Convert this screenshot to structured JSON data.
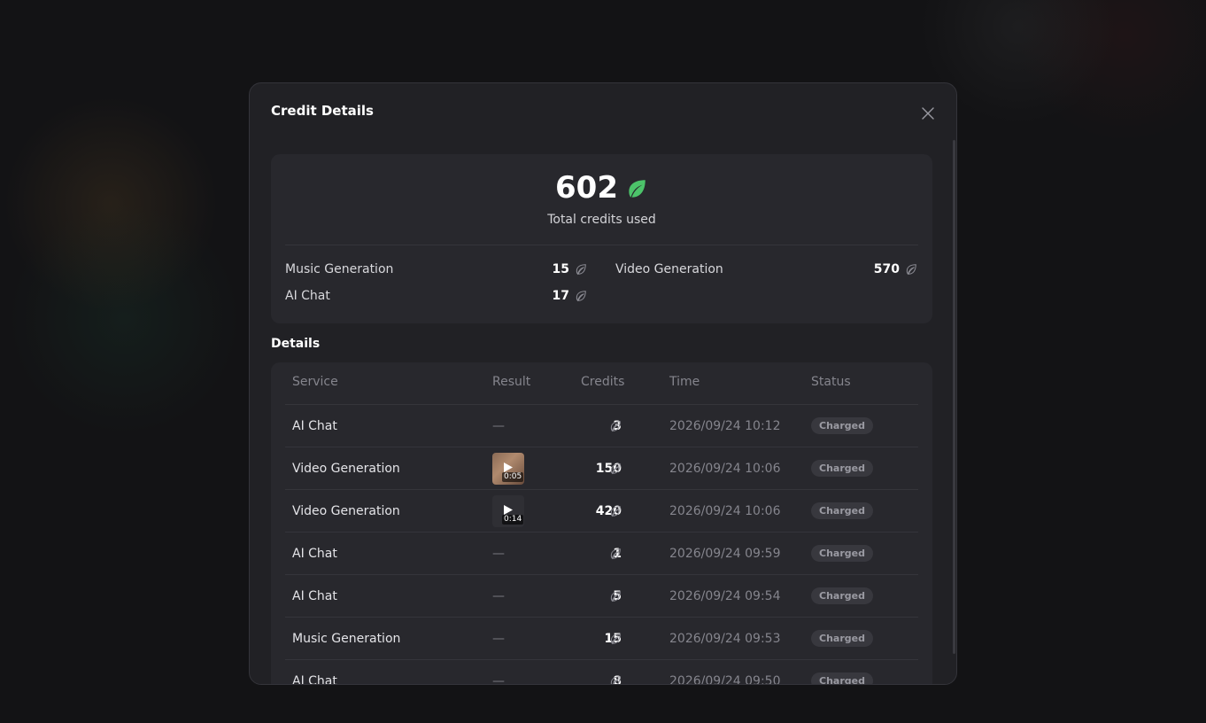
{
  "modal": {
    "title": "Credit Details"
  },
  "summary": {
    "total": "602",
    "total_label": "Total credits used",
    "breakdown": [
      {
        "name": "Music Generation",
        "amount": "15"
      },
      {
        "name": "Video Generation",
        "amount": "570"
      },
      {
        "name": "AI Chat",
        "amount": "17"
      }
    ]
  },
  "details": {
    "heading": "Details",
    "columns": {
      "service": "Service",
      "result": "Result",
      "credits": "Credits",
      "time": "Time",
      "status": "Status"
    },
    "rows": [
      {
        "service": "AI Chat",
        "result": "—",
        "credits": "3",
        "time": "2026/09/24 10:12",
        "status": "Charged"
      },
      {
        "service": "Video Generation",
        "result_thumb": "photo",
        "duration": "0:05",
        "credits": "150",
        "time": "2026/09/24 10:06",
        "status": "Charged"
      },
      {
        "service": "Video Generation",
        "result_thumb": "dark",
        "duration": "0:14",
        "credits": "420",
        "time": "2026/09/24 10:06",
        "status": "Charged"
      },
      {
        "service": "AI Chat",
        "result": "—",
        "credits": "1",
        "time": "2026/09/24 09:59",
        "status": "Charged"
      },
      {
        "service": "AI Chat",
        "result": "—",
        "credits": "5",
        "time": "2026/09/24 09:54",
        "status": "Charged"
      },
      {
        "service": "Music Generation",
        "result": "—",
        "credits": "15",
        "time": "2026/09/24 09:53",
        "status": "Charged"
      },
      {
        "service": "AI Chat",
        "result": "—",
        "credits": "8",
        "time": "2026/09/24 09:50",
        "status": "Charged"
      }
    ]
  },
  "icons": {
    "close": "close-icon",
    "credit": "leaf-icon",
    "play": "play-icon"
  },
  "colors": {
    "accent_leaf": "#4cc36a",
    "modal_bg": "#212125",
    "card_bg": "#28282d"
  }
}
